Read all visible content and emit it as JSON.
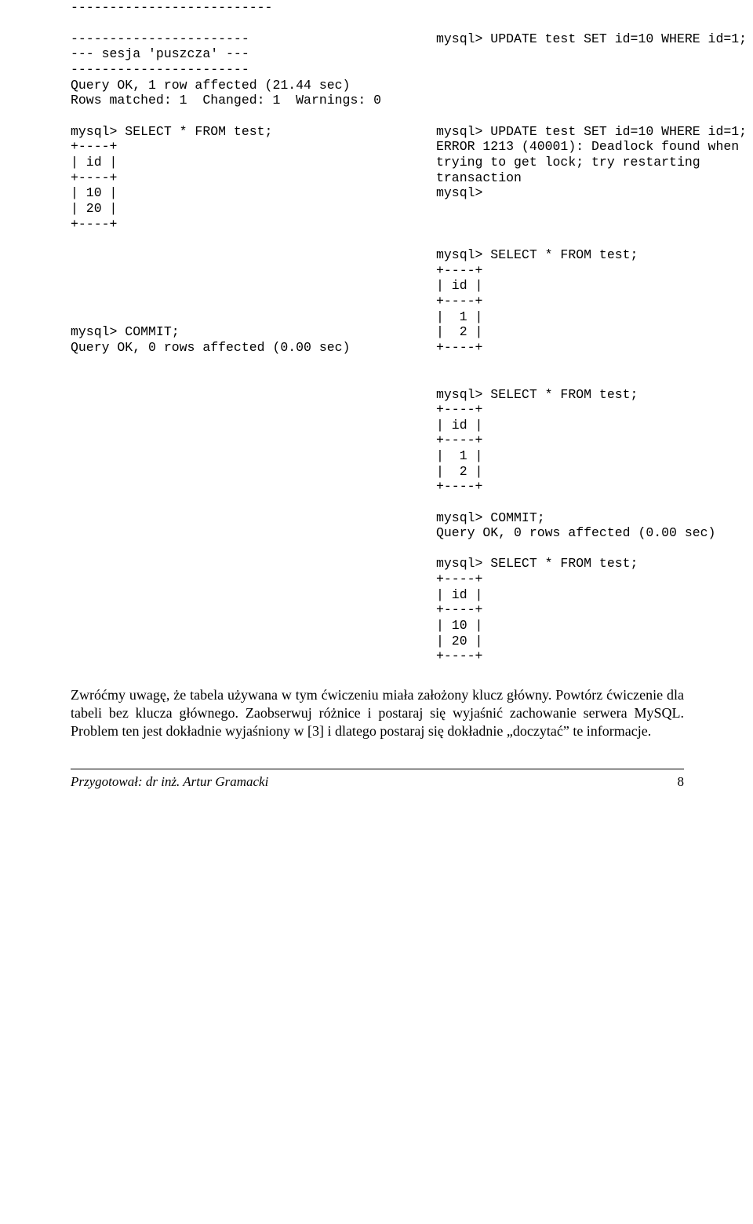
{
  "top_dashes": "--------------------------",
  "block1_left": "-----------------------\n--- sesja 'puszcza' ---\n-----------------------\nQuery OK, 1 row affected (21.44 sec)\nRows matched: 1  Changed: 1  Warnings: 0",
  "block1_right": "mysql> UPDATE test SET id=10 WHERE id=1;",
  "block2_left": "mysql> SELECT * FROM test;\n+----+\n| id |\n+----+\n| 10 |\n| 20 |\n+----+",
  "block2_right": "mysql> UPDATE test SET id=10 WHERE id=1;\nERROR 1213 (40001): Deadlock found when\ntrying to get lock; try restarting\ntransaction\nmysql>",
  "block3_left": "mysql> COMMIT;\nQuery OK, 0 rows affected (0.00 sec)",
  "block3_right": "mysql> SELECT * FROM test;\n+----+\n| id |\n+----+\n|  1 |\n|  2 |\n+----+",
  "block4_right": "mysql> SELECT * FROM test;\n+----+\n| id |\n+----+\n|  1 |\n|  2 |\n+----+\n\nmysql> COMMIT;\nQuery OK, 0 rows affected (0.00 sec)\n\nmysql> SELECT * FROM test;\n+----+\n| id |\n+----+\n| 10 |\n| 20 |\n+----+",
  "paragraph": "Zwróćmy uwagę, że tabela używana w tym ćwiczeniu miała założony klucz główny. Powtórz ćwiczenie dla tabeli bez klucza głównego. Zaobserwuj różnice i postaraj się wyjaśnić zachowanie serwera MySQL. Problem ten jest dokładnie wyjaśniony w [3] i dlatego postaraj się dokładnie „doczytać” te informacje.",
  "footer_left": "Przygotował: dr inż. Artur Gramacki",
  "footer_right": "8"
}
